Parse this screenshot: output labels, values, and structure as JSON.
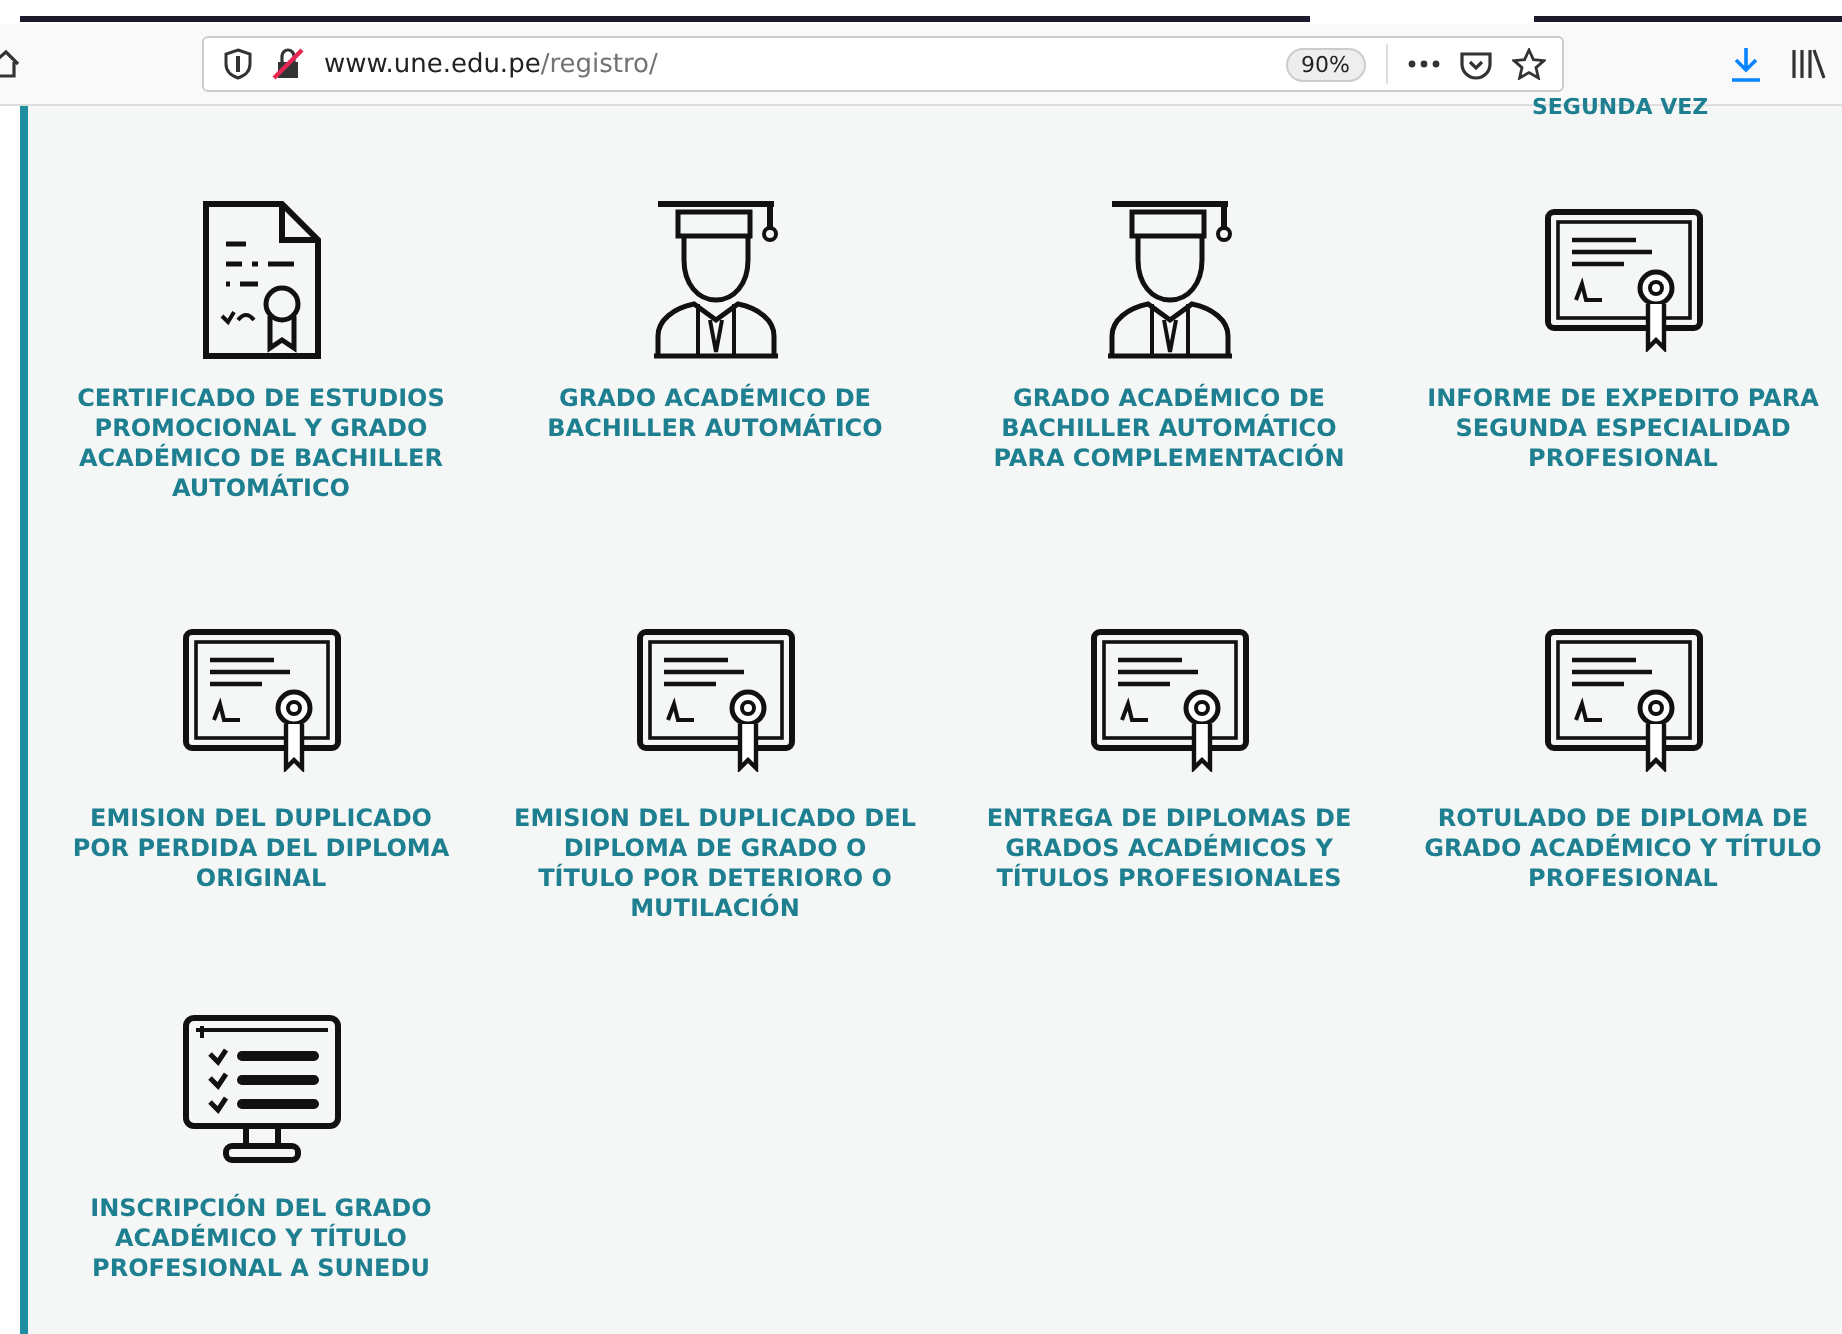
{
  "browser": {
    "url_host": "www.une.edu.pe",
    "url_path": "/registro/",
    "zoom": "90%"
  },
  "clipped_heading": "SEGUNDA VEZ",
  "services": [
    {
      "title": "CERTIFICADO DE ESTUDIOS PROMOCIONAL Y GRADO ACADÉMICO DE BACHILLER AUTOMÁTICO",
      "kind": "document"
    },
    {
      "title": "GRADO ACADÉMICO DE BACHILLER AUTOMÁTICO",
      "kind": "graduate"
    },
    {
      "title": "GRADO ACADÉMICO DE BACHILLER AUTOMÁTICO PARA COMPLEMENTACIÓN",
      "kind": "graduate"
    },
    {
      "title": "INFORME DE EXPEDITO PARA SEGUNDA ESPECIALIDAD PROFESIONAL",
      "kind": "diploma"
    },
    {
      "title": "EMISION DEL DUPLICADO POR PERDIDA DEL DIPLOMA ORIGINAL",
      "kind": "diploma"
    },
    {
      "title": "EMISION DEL DUPLICADO DEL DIPLOMA DE GRADO O TÍTULO POR DETERIORO O MUTILACIÓN",
      "kind": "diploma"
    },
    {
      "title": "ENTREGA DE DIPLOMAS DE GRADOS ACADÉMICOS Y TÍTULOS PROFESIONALES",
      "kind": "diploma"
    },
    {
      "title": "ROTULADO DE DIPLOMA DE GRADO ACADÉMICO Y TÍTULO PROFESIONAL",
      "kind": "diploma"
    },
    {
      "title": "INSCRIPCIÓN DEL GRADO ACADÉMICO Y TÍTULO PROFESIONAL A SUNEDU",
      "kind": "monitor"
    }
  ]
}
